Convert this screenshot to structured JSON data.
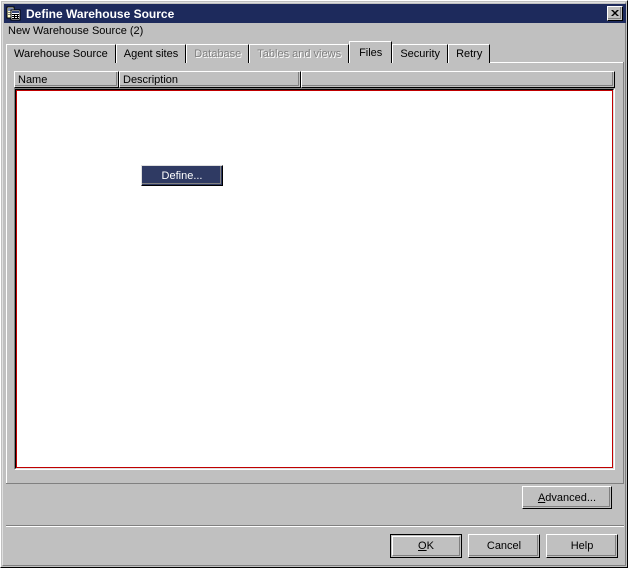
{
  "window": {
    "title": "Define Warehouse Source",
    "icon": "warehouse-source-icon",
    "close_label": "✕",
    "subtitle": "New Warehouse Source (2)"
  },
  "tabs": [
    {
      "label": "Warehouse Source",
      "state": "enabled",
      "mnemonic": ""
    },
    {
      "label": "Agent sites",
      "state": "enabled",
      "mnemonic": "g"
    },
    {
      "label": "Database",
      "state": "disabled",
      "mnemonic": ""
    },
    {
      "label": "Tables and views",
      "state": "disabled",
      "mnemonic": ""
    },
    {
      "label": "Files",
      "state": "active",
      "mnemonic": ""
    },
    {
      "label": "Security",
      "state": "enabled",
      "mnemonic": ""
    },
    {
      "label": "Retry",
      "state": "enabled",
      "mnemonic": ""
    }
  ],
  "files_tab": {
    "columns": [
      {
        "label": "Name"
      },
      {
        "label": "Description"
      },
      {
        "label": ""
      }
    ],
    "rows": [],
    "define_button": "Define...",
    "advanced_button": "Advanced..."
  },
  "footer": {
    "ok": "OK",
    "ok_mnemonic": "O",
    "cancel": "Cancel",
    "help": "Help"
  },
  "colors": {
    "titlebar": "#1d2a5c",
    "face": "#c0c0c0",
    "define_button_bg": "#2f3a63",
    "focus_border": "#c00000",
    "disabled_text": "#808080"
  }
}
